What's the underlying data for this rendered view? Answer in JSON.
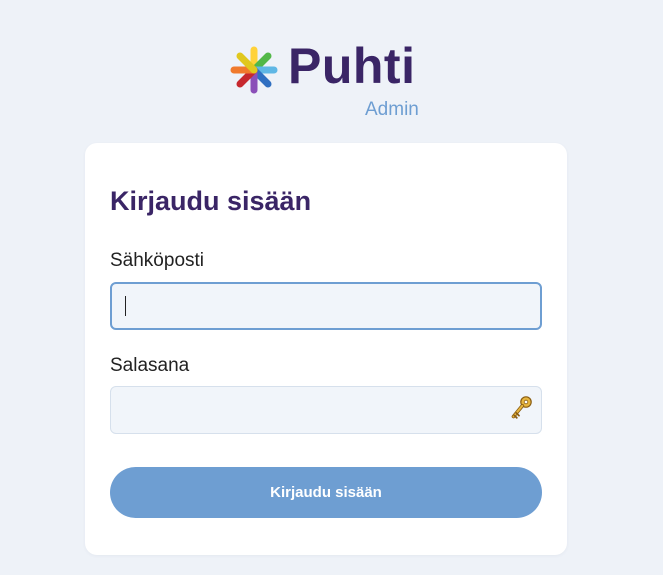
{
  "brand": {
    "name": "Puhti",
    "subtitle": "Admin",
    "logo_icon": "asterisk-multicolor-icon"
  },
  "login": {
    "title": "Kirjaudu sisään",
    "email_label": "Sähköposti",
    "email_value": "",
    "password_label": "Salasana",
    "password_value": "",
    "password_icon": "key-icon",
    "submit_label": "Kirjaudu sisään"
  },
  "colors": {
    "background": "#eef2f8",
    "brand_text": "#3a2566",
    "accent": "#6e9ed2",
    "card": "#ffffff",
    "input_bg": "#f1f5fa"
  }
}
